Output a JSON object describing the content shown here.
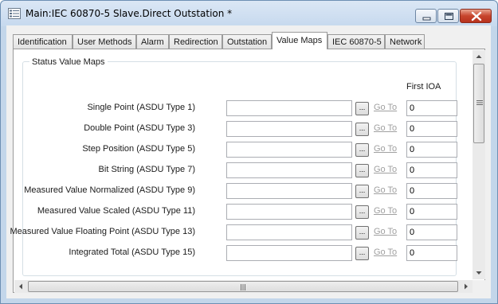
{
  "window": {
    "title": "Main:IEC 60870-5 Slave.Direct Outstation *",
    "app_icon": "document-list-icon",
    "controls": [
      "minimize-icon",
      "maximize-icon",
      "close-icon"
    ]
  },
  "tabs": [
    {
      "label": "Identification",
      "active": false
    },
    {
      "label": "User Methods",
      "active": false
    },
    {
      "label": "Alarm",
      "active": false
    },
    {
      "label": "Redirection",
      "active": false
    },
    {
      "label": "Outstation",
      "active": false
    },
    {
      "label": "Value Maps",
      "active": true
    },
    {
      "label": "IEC 60870-5",
      "active": false
    },
    {
      "label": "Network",
      "active": false
    }
  ],
  "group": {
    "title": "Status Value Maps",
    "column_header": "First IOA"
  },
  "rows": [
    {
      "label": "Single Point (ASDU Type 1)",
      "value": "",
      "browse": "...",
      "goto": "Go To",
      "ioa": "0"
    },
    {
      "label": "Double Point (ASDU Type 3)",
      "value": "",
      "browse": "...",
      "goto": "Go To",
      "ioa": "0"
    },
    {
      "label": "Step Position (ASDU Type 5)",
      "value": "",
      "browse": "...",
      "goto": "Go To",
      "ioa": "0"
    },
    {
      "label": "Bit String (ASDU Type 7)",
      "value": "",
      "browse": "...",
      "goto": "Go To",
      "ioa": "0"
    },
    {
      "label": "Measured Value Normalized (ASDU Type 9)",
      "value": "",
      "browse": "...",
      "goto": "Go To",
      "ioa": "0"
    },
    {
      "label": "Measured Value Scaled (ASDU Type 11)",
      "value": "",
      "browse": "...",
      "goto": "Go To",
      "ioa": "0"
    },
    {
      "label": "Measured Value Floating Point (ASDU Type 13)",
      "value": "",
      "browse": "...",
      "goto": "Go To",
      "ioa": "0"
    },
    {
      "label": "Integrated Total (ASDU Type 15)",
      "value": "",
      "browse": "...",
      "goto": "Go To",
      "ioa": "0"
    }
  ],
  "colors": {
    "title_bar": "#c6d9ee",
    "close_button": "#c7452d",
    "disabled_link": "#a0a0a0"
  }
}
